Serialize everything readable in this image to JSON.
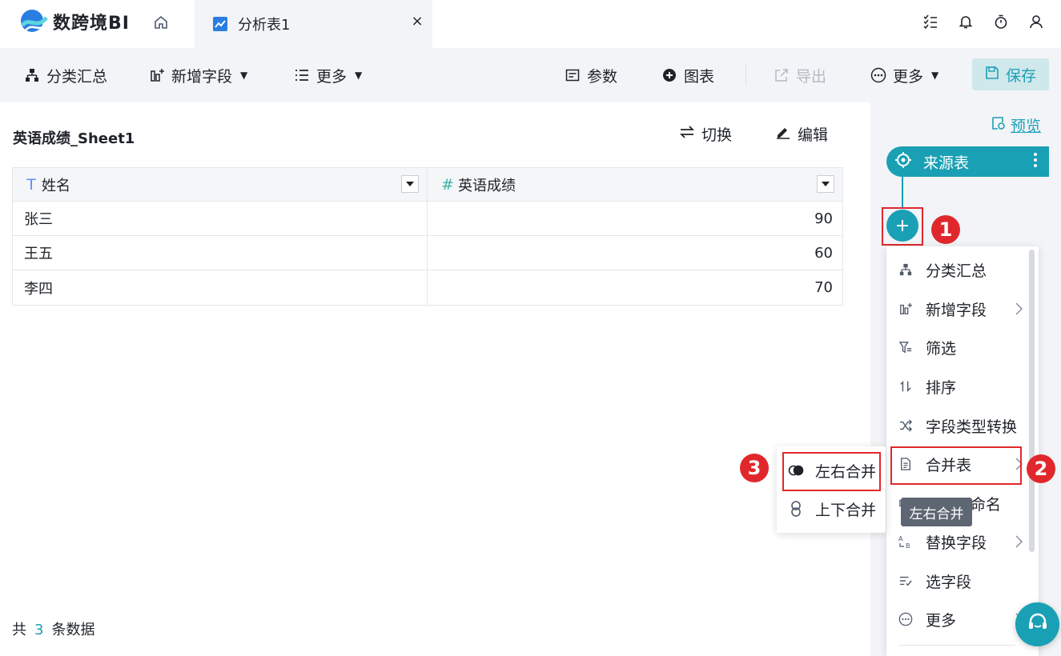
{
  "app": {
    "name": "数跨境BI"
  },
  "tabs": [
    {
      "label": "分析表1",
      "close": "×"
    }
  ],
  "toolbar": {
    "group_summary": "分类汇总",
    "add_field": "新增字段",
    "more_left": "更多",
    "params": "参数",
    "chart": "图表",
    "export": "导出",
    "more_right": "更多",
    "save": "保存"
  },
  "table_view": {
    "title": "英语成绩_Sheet1",
    "switch_label": "切换",
    "edit_label": "编辑",
    "columns": [
      {
        "type_icon": "T",
        "name": "姓名"
      },
      {
        "type_icon": "#",
        "name": "英语成绩"
      }
    ],
    "rows": [
      {
        "name": "张三",
        "score": "90"
      },
      {
        "name": "王五",
        "score": "60"
      },
      {
        "name": "李四",
        "score": "70"
      }
    ],
    "footer": {
      "prefix": "共",
      "count": "3",
      "suffix": "条数据"
    }
  },
  "flow_panel": {
    "preview": "预览",
    "source_node": "来源表",
    "add_symbol": "+",
    "menu": [
      {
        "label": "分类汇总",
        "icon": "hierarchy-icon",
        "has_sub": false
      },
      {
        "label": "新增字段",
        "icon": "add-field-icon",
        "has_sub": true
      },
      {
        "label": "筛选",
        "icon": "filter-icon",
        "has_sub": false
      },
      {
        "label": "排序",
        "icon": "sort-icon",
        "has_sub": false
      },
      {
        "label": "字段类型转换",
        "icon": "shuffle-icon",
        "has_sub": false
      },
      {
        "label": "合并表",
        "icon": "merge-doc-icon",
        "has_sub": true
      },
      {
        "label": "命名",
        "icon": "rename-icon",
        "has_sub": false
      },
      {
        "label": "替换字段",
        "icon": "replace-icon",
        "has_sub": true
      },
      {
        "label": "选字段",
        "icon": "select-field-icon",
        "has_sub": false
      },
      {
        "label": "更多",
        "icon": "more-circle-icon",
        "has_sub": true
      }
    ],
    "tooltip": "左右合并",
    "submenu": [
      {
        "label": "左右合并",
        "icon": "venn-icon"
      },
      {
        "label": "上下合并",
        "icon": "link-vertical-icon"
      }
    ]
  },
  "annotations": {
    "badge1": "1",
    "badge2": "2",
    "badge3": "3"
  },
  "colors": {
    "accent": "#1aa0b5",
    "annotation": "#e0282c",
    "toolbar_bg": "#f2f4f7"
  }
}
